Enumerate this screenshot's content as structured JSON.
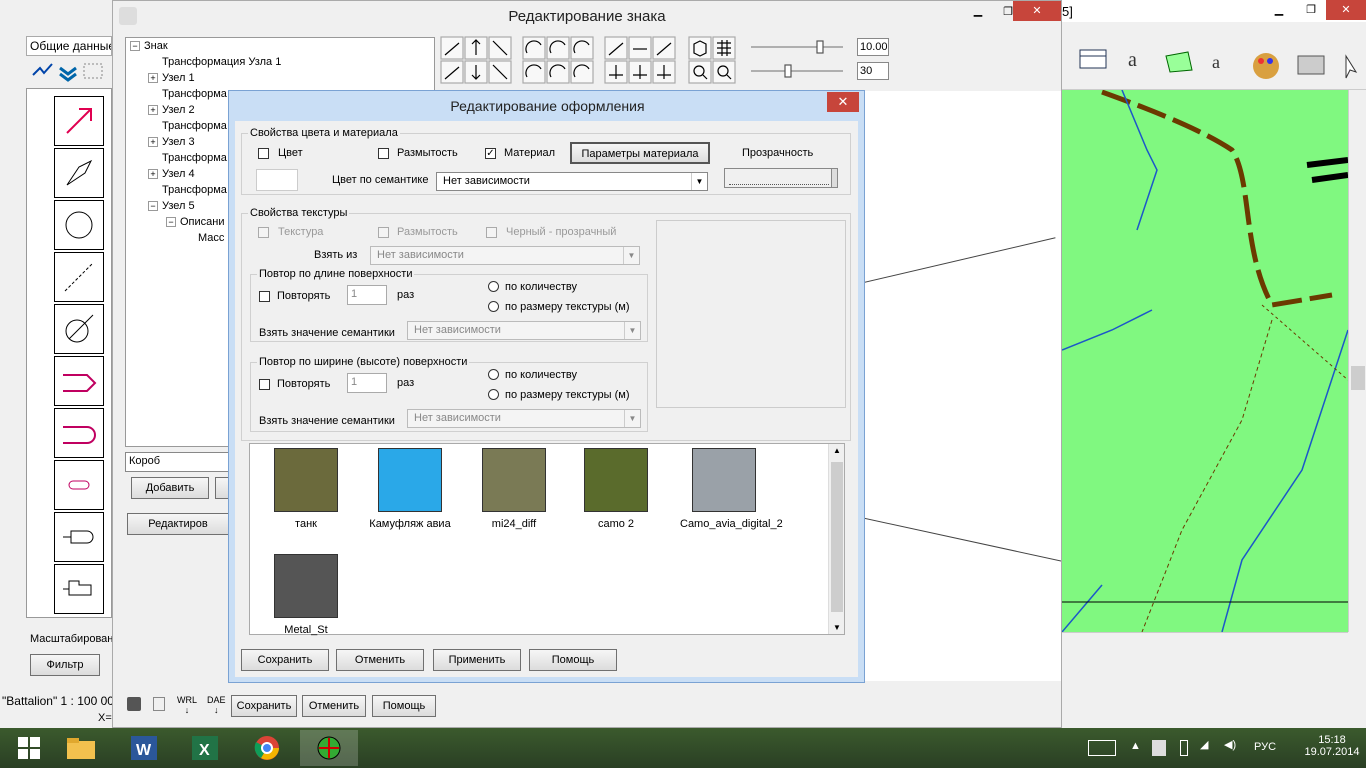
{
  "bg_app": {
    "title_fragment": "5]",
    "status": "\"Battalion\"  1 : 100 00",
    "x_label": "X=",
    "left_tab": "Общие данные",
    "scale_label": "Масштабирован",
    "filter_button": "Фильтр"
  },
  "sign_editor": {
    "title": "Редактирование знака",
    "value1": "10.00",
    "value2": "30",
    "tree": [
      {
        "label": "Знак",
        "expander": "−"
      },
      {
        "label": "Трансформация Узла 1",
        "expander": ""
      },
      {
        "label": "Узел 1",
        "expander": "+"
      },
      {
        "label": "Трансформа",
        "expander": ""
      },
      {
        "label": "Узел 2",
        "expander": "+"
      },
      {
        "label": "Трансформа",
        "expander": ""
      },
      {
        "label": "Узел 3",
        "expander": "+"
      },
      {
        "label": "Трансформа",
        "expander": ""
      },
      {
        "label": "Узел 4",
        "expander": "+"
      },
      {
        "label": "Трансформа",
        "expander": ""
      },
      {
        "label": "Узел 5",
        "expander": "−"
      },
      {
        "label": "Описани",
        "expander": "−"
      },
      {
        "label": "Масс",
        "expander": ""
      }
    ],
    "name_value": "Короб",
    "add_button": "Добавить",
    "edit_button": "Редактиров",
    "bottom_buttons": {
      "save": "Сохранить",
      "cancel": "Отменить",
      "help": "Помощь"
    },
    "bottom_icons": {
      "wrl": "WRL",
      "dae": "DAE"
    }
  },
  "dialog": {
    "title": "Редактирование оформления",
    "close": "✕",
    "color_group": {
      "title": "Свойства цвета и материала",
      "color_label": "Цвет",
      "color_checked": false,
      "blur_label": "Размытость",
      "blur_checked": false,
      "material_label": "Материал",
      "material_checked": true,
      "material_params_button": "Параметры материала",
      "transparency_label": "Прозрачность",
      "semantic_color_label": "Цвет по семантике",
      "semantic_color_value": "Нет зависимости"
    },
    "texture_group": {
      "title": "Свойства текстуры",
      "texture_label": "Текстура",
      "blur_label": "Размытость",
      "black_transparent_label": "Черный - прозрачный",
      "take_from_label": "Взять из",
      "take_from_value": "Нет зависимости",
      "length_repeat": {
        "title": "Повтор по длине поверхности",
        "repeat_label": "Повторять",
        "count_value": "1",
        "times_label": "раз",
        "by_count": "по количеству",
        "by_texture_size": "по размеру текстуры (м)",
        "semantic_label": "Взять значение семантики",
        "semantic_value": "Нет зависимости"
      },
      "width_repeat": {
        "title": "Повтор по ширине (высоте) поверхности",
        "repeat_label": "Повторять",
        "count_value": "1",
        "times_label": "раз",
        "by_count": "по количеству",
        "by_texture_size": "по размеру текстуры (м)",
        "semantic_label": "Взять значение семантики",
        "semantic_value": "Нет зависимости"
      }
    },
    "textures": [
      {
        "name": "танк",
        "color": "#6b6a3c"
      },
      {
        "name": "Камуфляж авиа",
        "color": "#2aa8e8"
      },
      {
        "name": "mi24_diff",
        "color": "#7a7a55"
      },
      {
        "name": "camo 2",
        "color": "#5a6b2c"
      },
      {
        "name": "Camo_avia_digital_2",
        "color": "#9aa1a8"
      },
      {
        "name": "Metal_St",
        "color": "#555555"
      }
    ],
    "buttons": {
      "save": "Сохранить",
      "cancel": "Отменить",
      "apply": "Применить",
      "help": "Помощь"
    }
  },
  "taskbar": {
    "lang": "РУС",
    "time": "15:18",
    "date": "19.07.2014"
  }
}
